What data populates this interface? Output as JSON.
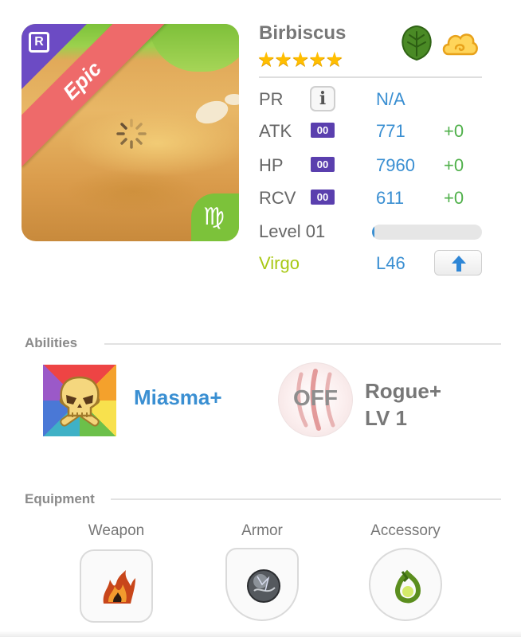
{
  "unit": {
    "name": "Birbiscus",
    "rarity_badge": "R",
    "rarity_ribbon": "Epic",
    "stars": "★★★★★",
    "zodiac_symbol": "♍",
    "element_icons": [
      "leaf-icon",
      "cloud-icon"
    ]
  },
  "stats": {
    "pr": {
      "label": "PR",
      "info_icon": "i",
      "value": "N/A"
    },
    "atk": {
      "label": "ATK",
      "badge": "00",
      "value": "771",
      "bonus": "+0"
    },
    "hp": {
      "label": "HP",
      "badge": "00",
      "value": "7960",
      "bonus": "+0"
    },
    "rcv": {
      "label": "RCV",
      "badge": "00",
      "value": "611",
      "bonus": "+0"
    },
    "level": {
      "label": "Level 01",
      "xp_progress": 0.02
    },
    "zodiac": {
      "label": "Virgo",
      "value": "L46"
    }
  },
  "abilities": {
    "title": "Abilities",
    "primary": {
      "name": "Miasma+"
    },
    "secondary": {
      "status": "OFF",
      "name_line1": "Rogue+",
      "name_line2": "LV 1"
    }
  },
  "equipment": {
    "title": "Equipment",
    "slots": [
      {
        "label": "Weapon"
      },
      {
        "label": "Armor"
      },
      {
        "label": "Accessory"
      }
    ]
  },
  "colors": {
    "accent_blue": "#3a8fd2",
    "bonus_green": "#4fb04a",
    "epic_ribbon": "#ee6a6a",
    "rarity_purple": "#6c4bc4",
    "zodiac_green": "#a9c815",
    "star_gold": "#ffbe00"
  }
}
